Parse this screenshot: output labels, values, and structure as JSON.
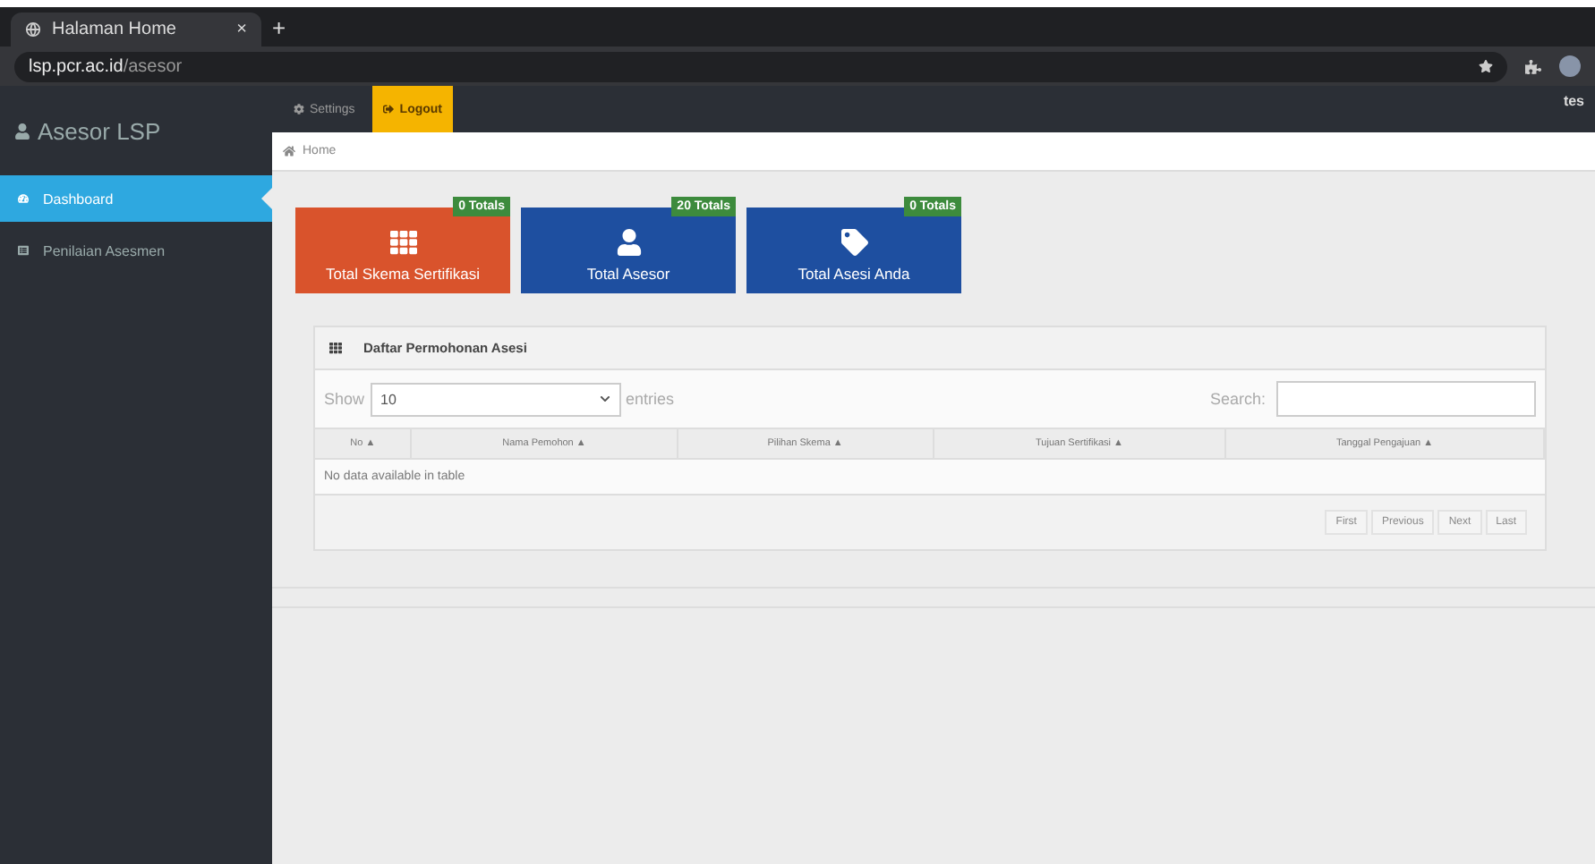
{
  "browser": {
    "tab_title": "Halaman Home",
    "tab_close": "×",
    "new_tab": "+",
    "url_host": "lsp.pcr.ac.id",
    "url_path": "/asesor"
  },
  "brand": "Asesor LSP",
  "sidebar": {
    "items": [
      {
        "label": "Dashboard",
        "selected": true
      },
      {
        "label": "Penilaian Asesmen",
        "selected": false
      }
    ]
  },
  "topbar": {
    "buttons": [
      {
        "label": "Settings",
        "selected": false
      },
      {
        "label": "Logout",
        "selected": true
      }
    ],
    "user": "tes"
  },
  "breadcrumb": "Home",
  "stat_boxes": [
    {
      "label": "Total Skema Sertifikasi",
      "badge": "0 Totals",
      "color": "#d9532c",
      "kind": "grid"
    },
    {
      "label": "Total Asesor",
      "badge": "20 Totals",
      "color": "#1e4fa0",
      "kind": "user"
    },
    {
      "label": "Total Asesi Anda",
      "badge": "0 Totals",
      "color": "#1e4fa0",
      "kind": "tag"
    }
  ],
  "panel": {
    "title": "Daftar Permohonan Asesi",
    "show_label": "Show",
    "page_size": "10",
    "entries_label": "entries",
    "search_label": "Search:",
    "columns": [
      "No ▲",
      "Nama Pemohon ▲",
      "Pilihan Skema ▲",
      "Tujuan Sertifikasi ▲",
      "Tanggal Pengajuan ▲"
    ],
    "empty_message": "No data available in table",
    "pagination": [
      {
        "label": "First",
        "disabled": true
      },
      {
        "label": "Previous",
        "disabled": true
      },
      {
        "label": "Next",
        "disabled": true
      },
      {
        "label": "Last",
        "disabled": true
      }
    ]
  }
}
